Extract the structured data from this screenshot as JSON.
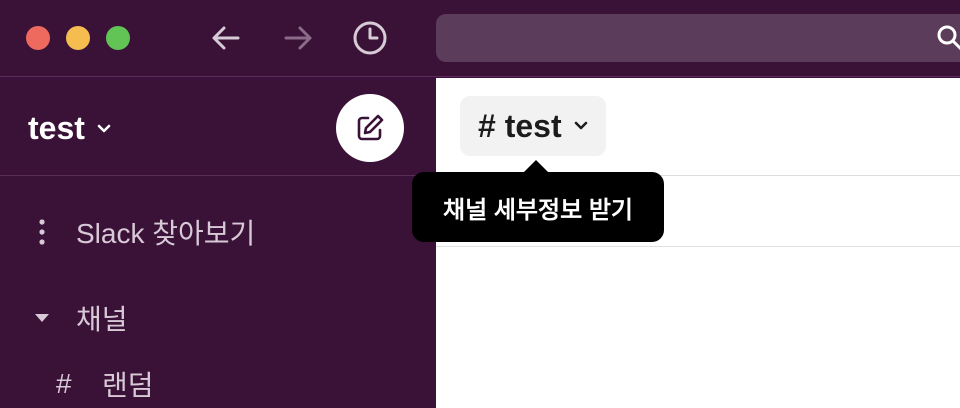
{
  "titlebar": {
    "buttons": [
      "close",
      "minimize",
      "zoom"
    ],
    "nav": {
      "back_icon": "arrow-left-icon",
      "forward_icon": "arrow-right-icon",
      "history_icon": "clock-icon"
    },
    "search": {
      "icon": "search-icon",
      "placeholder": ""
    }
  },
  "sidebar": {
    "workspace_name": "test",
    "compose_icon": "compose-icon",
    "items": [
      {
        "label": "Slack 찾아보기",
        "icon": "more-vertical-icon"
      },
      {
        "label": "채널",
        "icon": "caret-down-icon"
      },
      {
        "label": "랜덤",
        "icon": "#"
      }
    ]
  },
  "main": {
    "channel_title": "# test",
    "tooltip": "채널 세부정보 받기"
  },
  "colors": {
    "sidebar_bg": "#3a1238",
    "search_bg": "#5b3d5b",
    "tooltip_bg": "#000000",
    "close": "#ee6a5f",
    "minimize": "#f5bd4f",
    "zoom": "#61c454"
  }
}
